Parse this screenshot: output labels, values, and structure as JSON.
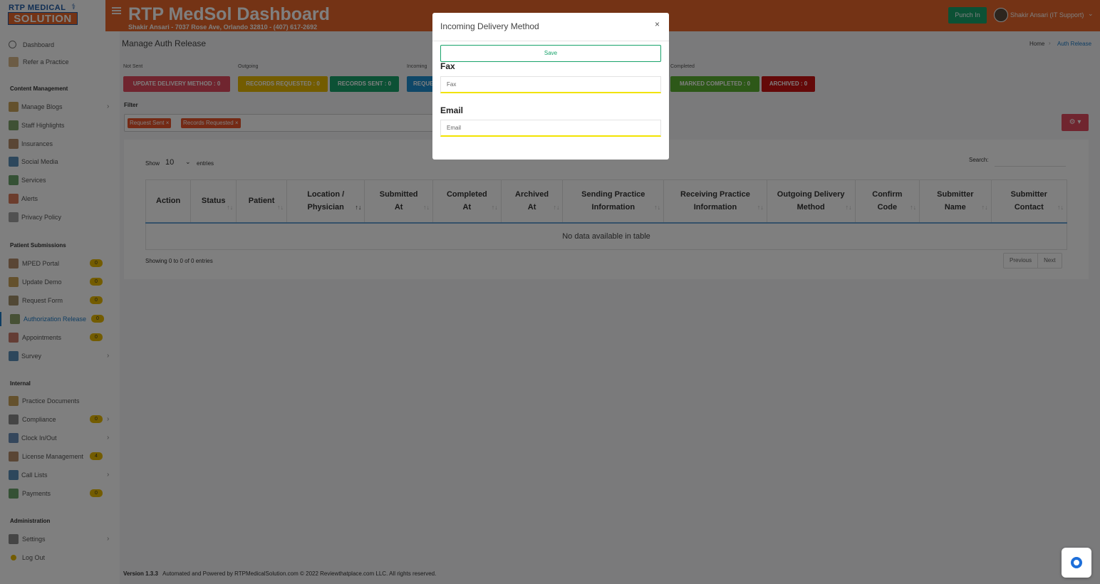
{
  "header": {
    "logo_top": "RTP MEDICAL",
    "logo_bottom": "SOLUTION",
    "title": "RTP MedSol Dashboard",
    "subtitle": "Shakir Ansari - 7037 Rose Ave, Orlando 32810 - (407) 617-2692",
    "punch_label": "Punch In",
    "user_name": "Shakir Ansari (IT Support)"
  },
  "sidebar": {
    "top_items": [
      {
        "label": "Dashboard"
      },
      {
        "label": "Refer a Practice"
      }
    ],
    "sections": [
      {
        "title": "Content Management",
        "items": [
          {
            "label": "Manage Blogs",
            "chevron": true
          },
          {
            "label": "Staff Highlights"
          },
          {
            "label": "Insurances"
          },
          {
            "label": "Social Media"
          },
          {
            "label": "Services"
          },
          {
            "label": "Alerts"
          },
          {
            "label": "Privacy Policy"
          }
        ]
      },
      {
        "title": "Patient Submissions",
        "items": [
          {
            "label": "MPED Portal",
            "badge": "0"
          },
          {
            "label": "Update Demo",
            "badge": "0"
          },
          {
            "label": "Request Form",
            "badge": "0"
          },
          {
            "label": "Authorization Release",
            "badge": "0",
            "active": true
          },
          {
            "label": "Appointments",
            "badge": "0"
          },
          {
            "label": "Survey",
            "chevron": true
          }
        ]
      },
      {
        "title": "Internal",
        "items": [
          {
            "label": "Practice Documents"
          },
          {
            "label": "Compliance",
            "badge": "0",
            "chevron": true
          },
          {
            "label": "Clock In/Out",
            "chevron": true
          },
          {
            "label": "License Management",
            "badge": "4"
          },
          {
            "label": "Call Lists",
            "chevron": true
          },
          {
            "label": "Payments",
            "badge": "0"
          }
        ]
      },
      {
        "title": "Administration",
        "items": [
          {
            "label": "Settings",
            "chevron": true
          },
          {
            "label": "Log Out"
          }
        ]
      }
    ]
  },
  "main": {
    "page_title": "Manage Auth Release",
    "breadcrumb_home": "Home",
    "breadcrumb_current": "Auth Release",
    "group_labels": {
      "not_sent": "Not Sent",
      "outgoing": "Outgoing",
      "incoming": "Incoming",
      "completed": "Completed"
    },
    "stats": {
      "update_delivery": "UPDATE DELIVERY METHOD : 0",
      "records_requested": "RECORDS REQUESTED : 0",
      "records_sent": "RECORDS SENT : 0",
      "request_sent": "REQUE",
      "marked_completed": "MARKED COMPLETED : 0",
      "archived": "ARCHIVED : 0"
    },
    "filter_label": "Filter",
    "filter_chips": [
      "Request Sent ×",
      "Records Requested ×"
    ],
    "table": {
      "show_label": "Show",
      "show_value": "10",
      "entries_label": "entries",
      "search_label": "Search:",
      "columns": [
        "Action",
        "Status",
        "Patient",
        "Location / Physician",
        "Submitted At",
        "Completed At",
        "Archived At",
        "Sending Practice Information",
        "Receiving Practice Information",
        "Outgoing Delivery Method",
        "Confirm Code",
        "Submitter Name",
        "Submitter Contact"
      ],
      "empty_message": "No data available in table",
      "showing": "Showing 0 to 0 of 0 entries",
      "prev_label": "Previous",
      "next_label": "Next"
    }
  },
  "footer": {
    "version": "Version 1.3.3",
    "text": "Automated and Powered by RTPMedicalSolution.com © 2022 Reviewthatplace.com LLC. All rights reserved."
  },
  "modal": {
    "title": "Incoming Delivery Method",
    "close_label": "×",
    "save_label": "Save",
    "fax_label": "Fax",
    "fax_placeholder": "Fax",
    "fax_value": "",
    "email_label": "Email",
    "email_placeholder": "Email",
    "email_value": ""
  },
  "colors": {
    "brand_orange": "#e8672b",
    "green": "#18a36b",
    "update_red": "#e04a5e",
    "records_yellow": "#e6b800",
    "incoming_blue": "#1f8fd1",
    "completed_green": "#5bb030",
    "archived_red": "#c81212"
  }
}
